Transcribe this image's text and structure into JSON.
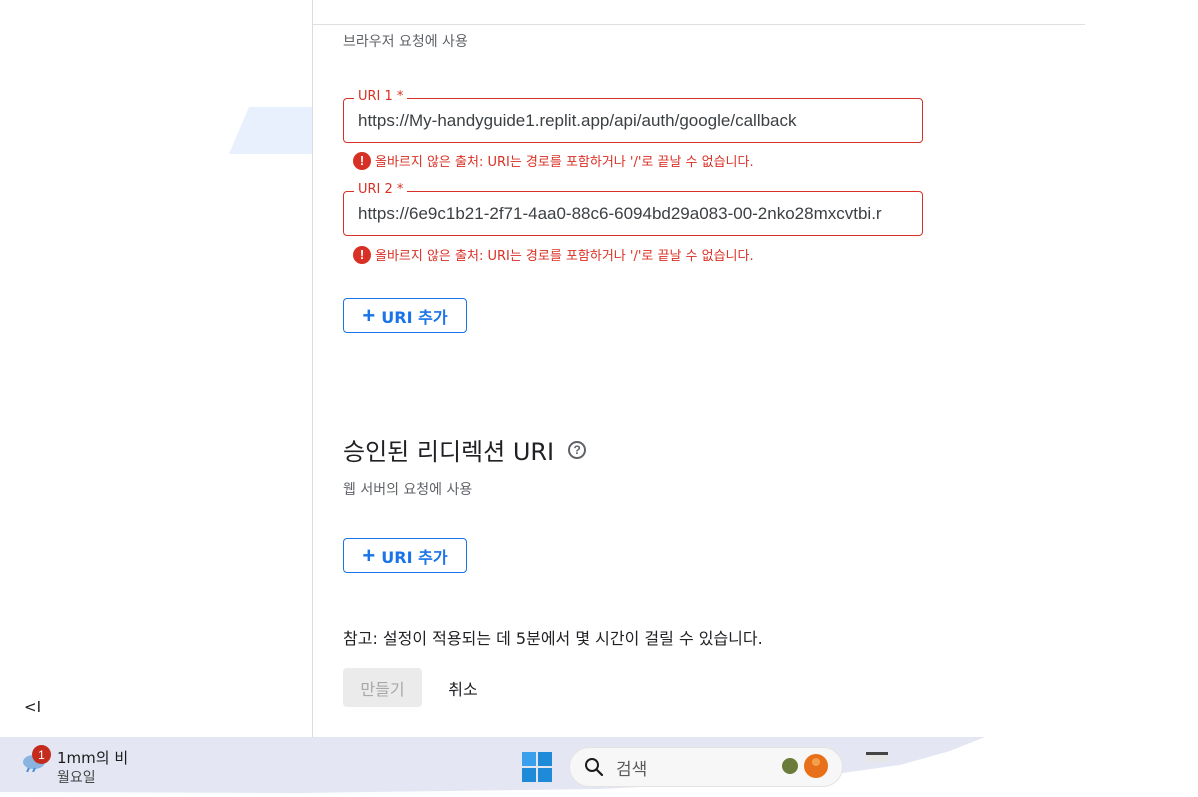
{
  "js_origins": {
    "hint": "브라우저 요청에 사용",
    "uris": [
      {
        "label": "URI 1 *",
        "value": "https://My-handyguide1.replit.app/api/auth/google/callback",
        "error": "올바르지 않은 출처: URI는 경로를 포함하거나 '/'로 끝날 수 없습니다."
      },
      {
        "label": "URI 2 *",
        "value": "https://6e9c1b21-2f71-4aa0-88c6-6094bd29a083-00-2nko28mxcvtbi.r",
        "error": "올바르지 않은 출처: URI는 경로를 포함하거나 '/'로 끝날 수 없습니다."
      }
    ],
    "add_button_label": "URI 추가"
  },
  "redirect_uris": {
    "title": "승인된 리디렉션 URI",
    "hint": "웹 서버의 요청에 사용",
    "add_button_label": "URI 추가"
  },
  "note": "참고: 설정이 적용되는 데 5분에서 몇 시간이 걸릴 수 있습니다.",
  "actions": {
    "create_label": "만들기",
    "cancel_label": "취소"
  },
  "sidebar": {
    "collapse_label": "<I"
  },
  "taskbar": {
    "weather_badge": "1",
    "weather_title": "1mm의 비",
    "weather_sub": "월요일",
    "search_placeholder": "검색"
  },
  "colors": {
    "error": "#d93025",
    "accent": "#1a73e8",
    "taskbar": "#e4e6f4"
  },
  "icons": {
    "error": "error-icon",
    "help": "help-icon",
    "add": "plus-icon",
    "search": "search-icon",
    "start": "windows-logo-icon",
    "weather": "weather-icon"
  }
}
